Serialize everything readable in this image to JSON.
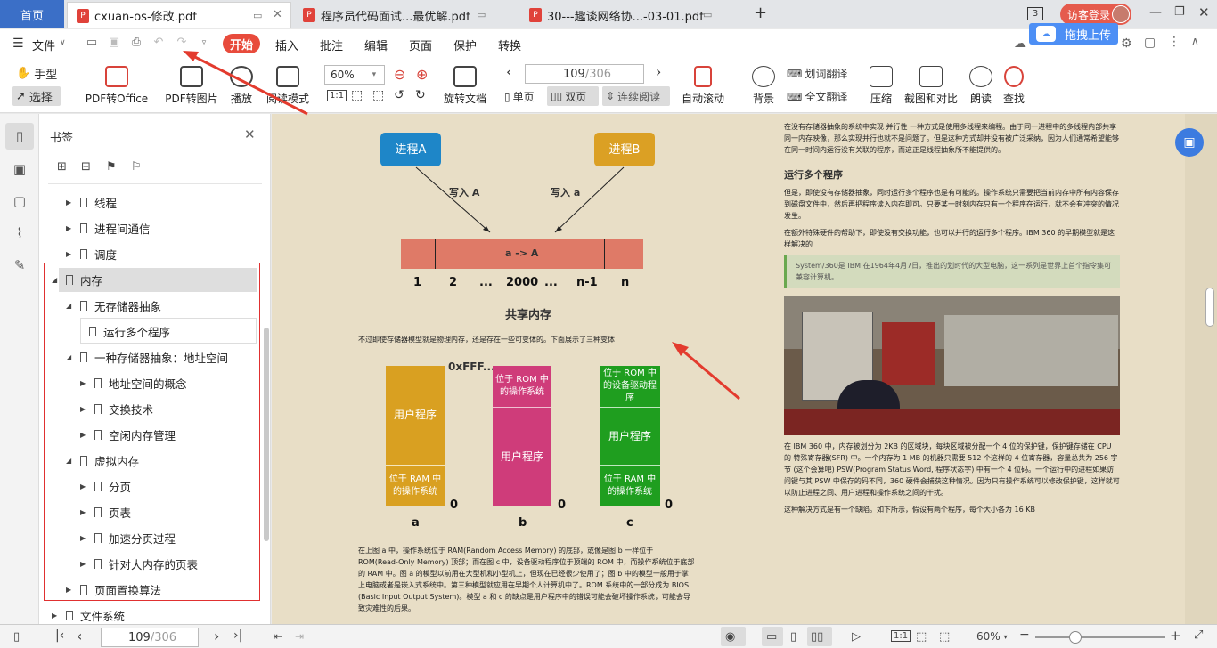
{
  "tabs": {
    "home": "首页",
    "doc1": "cxuan-os-修改.pdf",
    "doc2": "程序员代码面试...最优解.pdf",
    "doc3": "30---趣谈网络协...-03-01.pdf",
    "badge": "3",
    "login": "访客登录"
  },
  "menu": {
    "file": "文件",
    "start": "开始",
    "items": [
      "插入",
      "批注",
      "编辑",
      "页面",
      "保护",
      "转换"
    ],
    "upload": "拖拽上传"
  },
  "toolbar": {
    "hand": "手型",
    "select": "选择",
    "pdf_office": "PDF转Office",
    "pdf_image": "PDF转图片",
    "play": "播放",
    "read_mode": "阅读模式",
    "zoom": "60%",
    "rotate": "旋转文档",
    "page_current": "109",
    "page_total": "/306",
    "single": "单页",
    "double": "双页",
    "continuous": "连续阅读",
    "autoscroll": "自动滚动",
    "background": "背景",
    "word_translate": "划词翻译",
    "full_translate": "全文翻译",
    "compress": "压缩",
    "screenshot_compare": "截图和对比",
    "read_aloud": "朗读",
    "find": "查找"
  },
  "bookmarks": {
    "title": "书签",
    "items": [
      "线程",
      "进程间通信",
      "调度",
      "内存",
      "无存储器抽象",
      "运行多个程序",
      "一种存储器抽象：地址空间",
      "地址空间的概念",
      "交换技术",
      "空闲内存管理",
      "虚拟内存",
      "分页",
      "页表",
      "加速分页过程",
      "针对大内存的页表",
      "页面置换算法",
      "文件系统"
    ]
  },
  "doc_left": {
    "procA": "进程A",
    "procB": "进程B",
    "writeA": "写入 A",
    "writea": "写入 a",
    "cell": "a -> A",
    "nums": [
      "1",
      "2",
      "...",
      "2000",
      "...",
      "n-1",
      "n"
    ],
    "shared_title": "共享内存",
    "para1": "不过即使存储器模型就是物理内存，还是存在一些可变体的。下面展示了三种变体",
    "addr": "0xFFF...",
    "colA_top": "用户程序",
    "colA_bottom": "位于 RAM 中的操作系统",
    "colB_top": "位于 ROM 中的操作系统",
    "colB_bottom": "用户程序",
    "colC_top": "位于 ROM 中的设备驱动程序",
    "colC_mid": "用户程序",
    "colC_bottom": "位于 RAM 中的操作系统",
    "zero": "0",
    "labels": [
      "a",
      "b",
      "c"
    ],
    "para2": "在上图 a 中，操作系统位于 RAM(Random Access Memory) 的底部，或像是图 b 一样位于 ROM(Read-Only Memory) 顶部；而在图 c 中，设备驱动程序位于顶端的 ROM 中，而操作系统位于底部的 RAM 中。图 a 的模型以前用在大型机和小型机上，但现在已经很少使用了；图 b 中的模型一般用于掌上电脑或者是嵌入式系统中。第三种模型就应用在早期个人计算机中了。ROM 系统中的一部分成为 BIOS (Basic Input Output System)。模型 a 和 c 的缺点是用户程序中的错误可能会破坏操作系统，可能会导致灾难性的后果。"
  },
  "doc_right": {
    "para_top": "在没有存储器抽象的系统中实现 并行性 一种方式是使用多线程来编程。由于同一进程中的多线程内部共享同一内存映像，那么实现并行也就不是问题了。但是这种方式却并没有被广泛采纳，因为人们通常希望能够在同一时间内运行没有关联的程序，而这正是线程抽象所不能提供的。",
    "heading": "运行多个程序",
    "para2": "但是，即使没有存储器抽象，同时运行多个程序也是有可能的。操作系统只需要把当前内存中所有内容保存到磁盘文件中，然后再把程序读入内存即可。只要某一时刻内存只有一个程序在运行，就不会有冲突的情况发生。",
    "para3": "在额外特殊硬件的帮助下，即使没有交换功能，也可以并行的运行多个程序。IBM 360 的早期模型就是这样解决的",
    "quote": "System/360是 IBM 在1964年4月7日，推出的划时代的大型电脑，这一系列是世界上首个指令集可兼容计算机。",
    "para4": "在 IBM 360 中，内存被划分为 2KB 的区域块，每块区域被分配一个 4 位的保护键，保护键存储在 CPU 的 特殊寄存器(SFR) 中。一个内存为 1 MB 的机器只需要 512 个这样的 4 位寄存器，容量总共为 256 字节 (这个会算吧) PSW(Program Status Word, 程序状态字) 中有一个 4 位码。一个运行中的进程如果访问键与其 PSW 中保存的码不同，360 硬件会捕获这种情况。因为只有操作系统可以修改保护键，这样就可以防止进程之间、用户进程和操作系统之间的干扰。",
    "para5": "这种解决方式是有一个缺陷。如下所示，假设有两个程序，每个大小各为 16 KB"
  },
  "status": {
    "page_current": "109",
    "page_total": "/306",
    "zoom": "60%"
  }
}
